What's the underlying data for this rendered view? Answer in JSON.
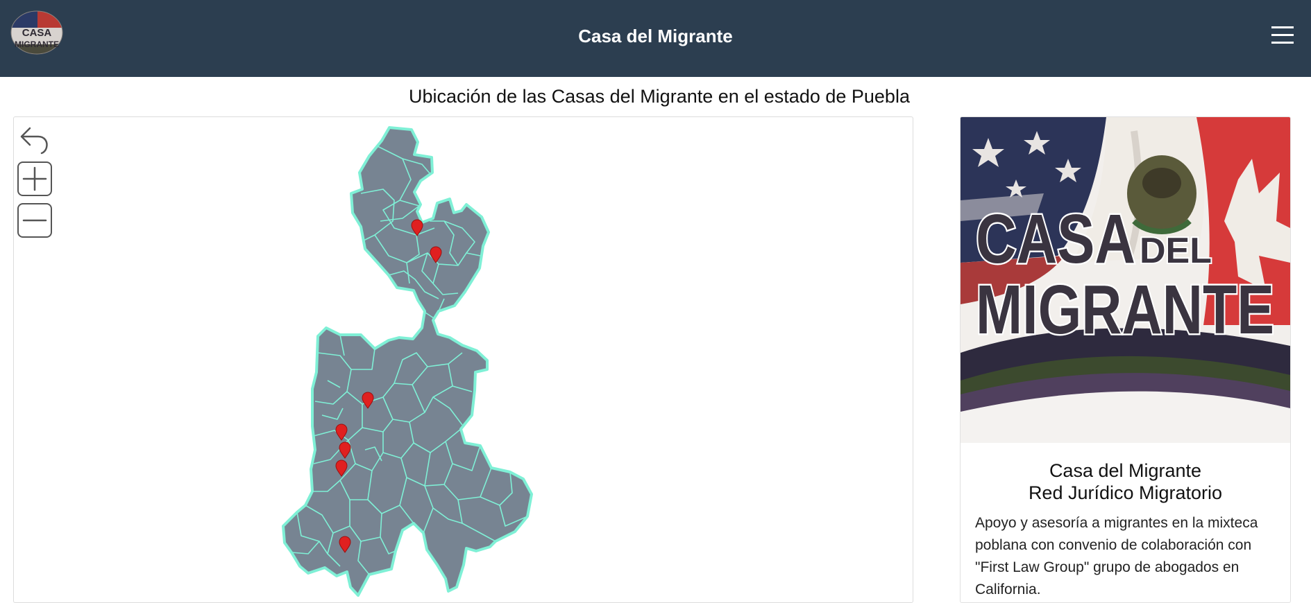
{
  "header": {
    "title": "Casa del Migrante",
    "logo_text": "CASA DEL MIGRANTE",
    "menu_icon": "hamburger-menu-icon",
    "background": "#2c3e50"
  },
  "page": {
    "heading": "Ubicación de las Casas del Migrante en el estado de Puebla"
  },
  "map": {
    "region_fill": "#778492",
    "border_color": "#7ff0d6",
    "marker_color": "#e02020",
    "marker_count": 7,
    "controls": [
      {
        "name": "back",
        "icon": "undo-arrow-icon"
      },
      {
        "name": "zoom-in",
        "icon": "plus-icon"
      },
      {
        "name": "zoom-out",
        "icon": "minus-icon"
      }
    ]
  },
  "card": {
    "image_text_line1": "CASA",
    "image_text_del": "DEL",
    "image_text_line2": "MIGRANTE",
    "title_line1": "Casa del Migrante",
    "title_line2": "Red Jurídico Migratorio",
    "description": "Apoyo y asesoría a migrantes en la mixteca poblana con convenio de colaboración con \"First Law Group\" grupo de abogados en California."
  }
}
